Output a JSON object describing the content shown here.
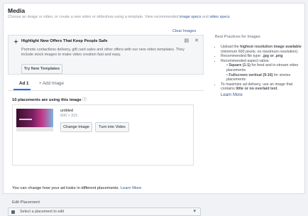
{
  "media": {
    "title": "Media",
    "subtitle_prefix": "Choose an image or video, or create a new video or slideshow using a template. View recommended",
    "image_specs": "image specs",
    "and": "and",
    "video_specs": "video specs",
    "clear_images": "Clear Images"
  },
  "banner": {
    "title": "Highlight New Offers That Keep People Safe",
    "text": "Promote contactless delivery, gift card sales and other offers with our new video templates. They include stock images to make video creation fast and easy.",
    "button": "Try New Templates"
  },
  "tabs": {
    "ad1": "Ad 1",
    "add_image": "Add Image"
  },
  "placements": {
    "count_text": "10 placements are using this image"
  },
  "image": {
    "name": "untitled",
    "dimensions": "600 × 315",
    "change_button": "Change Image",
    "video_button": "Turn into Video"
  },
  "change_look": {
    "text": "You can change how your ad looks in different placements.",
    "link": "Learn More"
  },
  "edit_placement": {
    "label": "Edit Placement",
    "select_placeholder": "Select a placement to edit"
  },
  "best_practices": {
    "title": "Best Practices for Images",
    "items": [
      {
        "pre": "Upload the ",
        "bold": "highest resolution image available",
        "post": " (minimum 600 pixels; no maximum resolution)."
      },
      {
        "pre": "Recommended file type: ",
        "bold": ".jpg or .png",
        "post": ""
      },
      {
        "pre": "Recommended aspect ratios:",
        "bold": "",
        "post": ""
      },
      {
        "pre": "To maximize ad delivery, use an image that contains ",
        "bold": "little or no overlaid text",
        "post": "."
      }
    ],
    "sub_items": [
      {
        "bold": "Square (1:1)",
        "post": " for feed and in-stream video placements"
      },
      {
        "bold": "Fullscreen vertical (9:16)",
        "post": " for stories placements"
      }
    ],
    "learn_more": "Learn More"
  }
}
